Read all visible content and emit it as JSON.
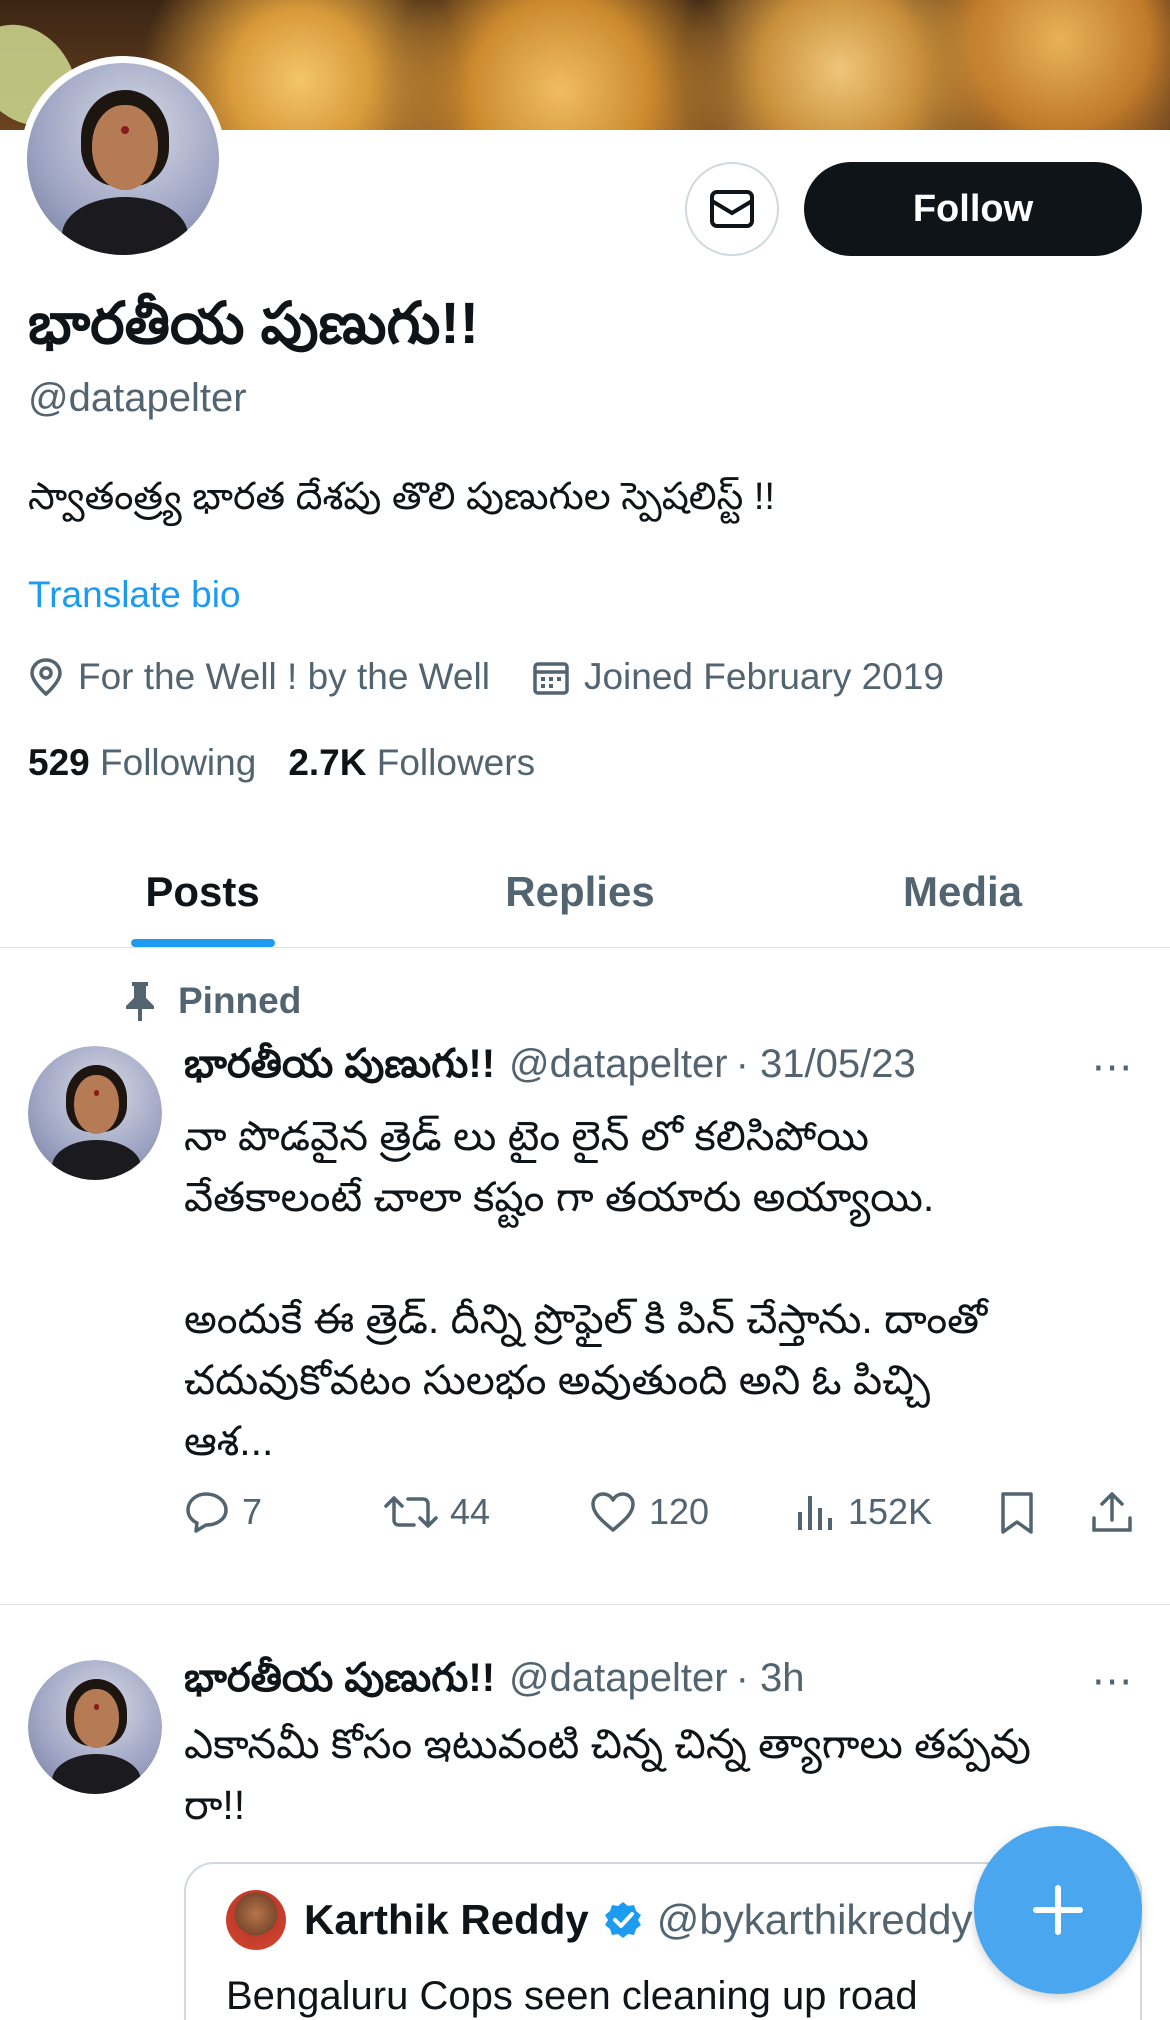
{
  "profile": {
    "name": "భారతీయ పుణుగు!!",
    "handle": "@datapelter",
    "bio": "స్వాతంత్ర్య భారత దేశపు తొలి పుణుగుల స్పెషలిస్ట్ !!",
    "translate_label": "Translate bio",
    "location": "For the Well ! by the Well",
    "joined": "Joined February 2019",
    "following_count": "529",
    "following_label": "Following",
    "followers_count": "2.7K",
    "followers_label": "Followers",
    "follow_button": "Follow"
  },
  "tabs": [
    {
      "label": "Posts",
      "active": true
    },
    {
      "label": "Replies",
      "active": false
    },
    {
      "label": "Media",
      "active": false
    }
  ],
  "posts": [
    {
      "pinned_label": "Pinned",
      "author": "భారతీయ పుణుగు!!",
      "handle": "@datapelter",
      "time": "· 31/05/23",
      "more": "···",
      "text": "నా పొడవైన త్రెడ్ లు టైం లైన్ లో కలిసిపోయి\nవేతకాలంటే చాలా కష్టం గా తయారు అయ్యాయి.\n\nఅందుకే ఈ త్రెడ్. దీన్ని ప్రొఫైల్ కి పిన్ చేస్తాను. దాంతో\nచదువుకోవటం సులభం అవుతుంది అని ఓ పిచ్చి\nఆశ...",
      "replies": "7",
      "reposts": "44",
      "likes": "120",
      "views": "152K"
    },
    {
      "author": "భారతీయ పుణుగు!!",
      "handle": "@datapelter",
      "time": "· 3h",
      "more": "···",
      "text": "ఎకానమీ కోసం ఇటువంటి చిన్న చిన్న త్యాగాలు తప్పవు\nరా!!",
      "quote": {
        "author": "Karthik Reddy",
        "handle": "@bykarthikreddy",
        "text": "Bengaluru Cops seen cleaning up road"
      }
    }
  ],
  "colors": {
    "accent": "#1d9bf0",
    "text": "#0f1419",
    "muted": "#536471",
    "fab": "#4aa6ee"
  },
  "icons": [
    "envelope-icon",
    "location-pin-icon",
    "calendar-icon",
    "pin-icon",
    "reply-icon",
    "repost-icon",
    "like-icon",
    "views-icon",
    "bookmark-icon",
    "share-icon",
    "more-icon",
    "verified-icon",
    "compose-plus-icon"
  ]
}
